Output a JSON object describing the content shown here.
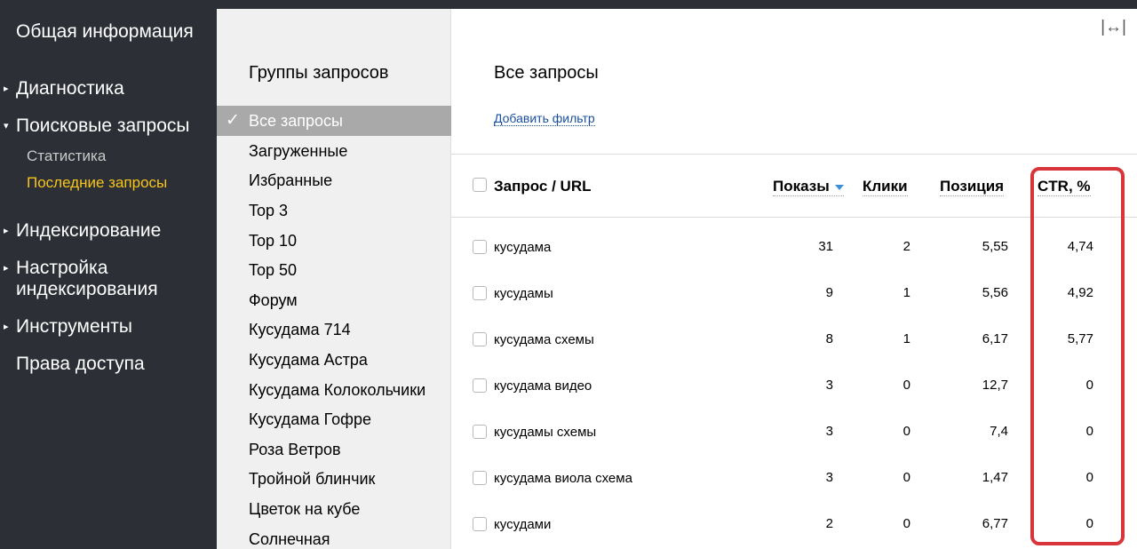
{
  "sidebar": {
    "items": [
      {
        "label": "Общая информация"
      },
      {
        "label": "Диагностика"
      },
      {
        "label": "Поисковые запросы"
      },
      {
        "label": "Индексирование"
      },
      {
        "label": "Настройка индексирования"
      },
      {
        "label": "Инструменты"
      },
      {
        "label": "Права доступа"
      }
    ],
    "sub_items": [
      {
        "label": "Статистика"
      },
      {
        "label": "Последние запросы"
      }
    ],
    "expanded_caret": "▾",
    "collapsed_caret": "▸"
  },
  "groups": {
    "title": "Группы запросов",
    "check": "✓",
    "items": [
      {
        "label": "Все запросы"
      },
      {
        "label": "Загруженные"
      },
      {
        "label": "Избранные"
      },
      {
        "label": "Top 3"
      },
      {
        "label": "Top 10"
      },
      {
        "label": "Top 50"
      },
      {
        "label": "Форум"
      },
      {
        "label": "Кусудама 714"
      },
      {
        "label": "Кусудама Астра"
      },
      {
        "label": "Кусудама Колокольчики"
      },
      {
        "label": "Кусудама Гофре"
      },
      {
        "label": "Роза Ветров"
      },
      {
        "label": "Тройной блинчик"
      },
      {
        "label": "Цветок на кубе"
      },
      {
        "label": "Солнечная"
      }
    ]
  },
  "main": {
    "title": "Все запросы",
    "add_filter": "Добавить фильтр",
    "expand_icon": "|↔|",
    "headers": {
      "query": "Запрос / URL",
      "shows": "Показы",
      "clicks": "Клики",
      "position": "Позиция",
      "ctr": "CTR, %"
    },
    "rows": [
      {
        "query": "кусудама",
        "shows": "31",
        "clicks": "2",
        "position": "5,55",
        "ctr": "4,74"
      },
      {
        "query": "кусудамы",
        "shows": "9",
        "clicks": "1",
        "position": "5,56",
        "ctr": "4,92"
      },
      {
        "query": "кусудама схемы",
        "shows": "8",
        "clicks": "1",
        "position": "6,17",
        "ctr": "5,77"
      },
      {
        "query": "кусудама видео",
        "shows": "3",
        "clicks": "0",
        "position": "12,7",
        "ctr": "0"
      },
      {
        "query": "кусудамы схемы",
        "shows": "3",
        "clicks": "0",
        "position": "7,4",
        "ctr": "0"
      },
      {
        "query": "кусудама виола схема",
        "shows": "3",
        "clicks": "0",
        "position": "1,47",
        "ctr": "0"
      },
      {
        "query": "кусудами",
        "shows": "2",
        "clicks": "0",
        "position": "6,77",
        "ctr": "0"
      }
    ]
  },
  "colors": {
    "sidebar_bg": "#2c3036",
    "active_sub": "#f7c518",
    "highlight_box": "#d9343a",
    "link": "#1a4fa0",
    "sort_arrow": "#3b8fd9"
  }
}
